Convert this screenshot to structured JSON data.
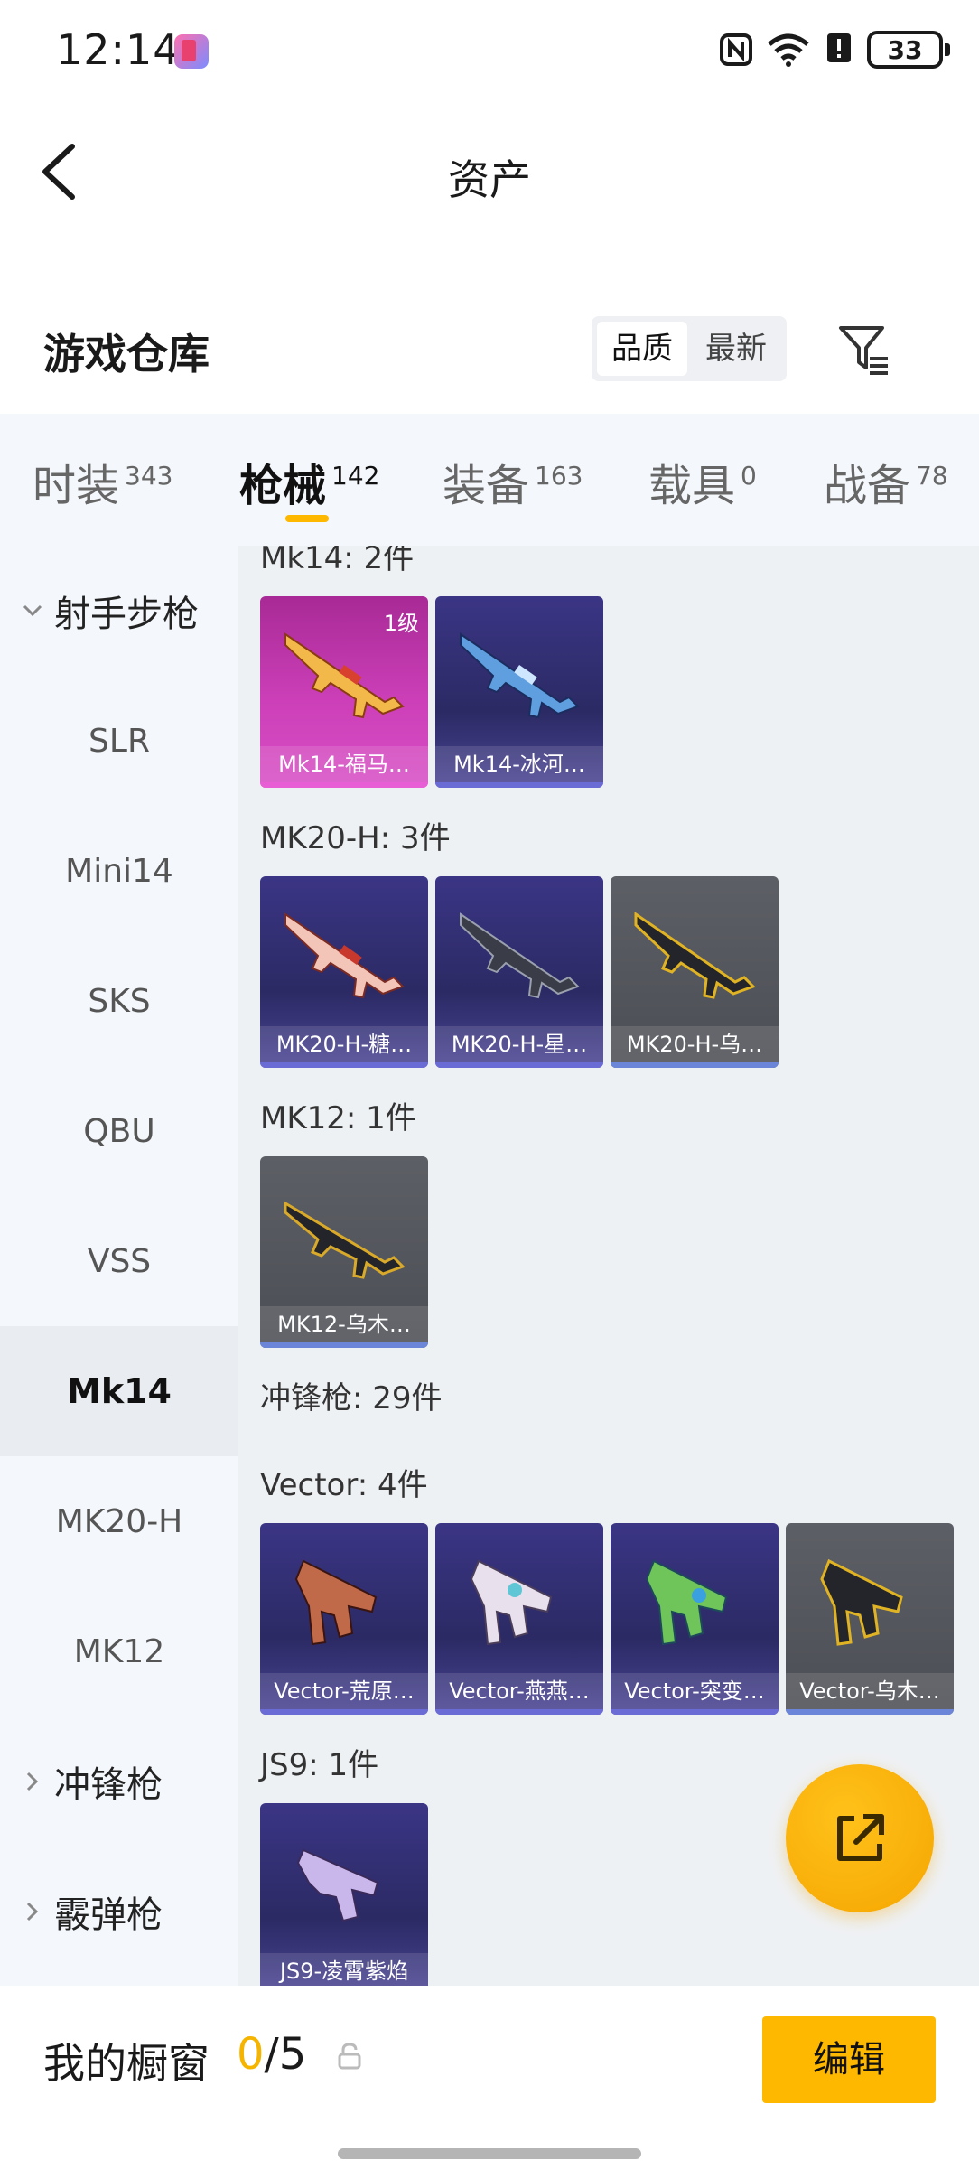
{
  "status_bar": {
    "time": "12:14",
    "battery": "33"
  },
  "header": {
    "title": "资产"
  },
  "warehouse": {
    "title": "游戏仓库",
    "sort_options": [
      "品质",
      "最新"
    ]
  },
  "tabs": [
    {
      "label": "时装",
      "count": "343"
    },
    {
      "label": "枪械",
      "count": "142"
    },
    {
      "label": "装备",
      "count": "163"
    },
    {
      "label": "载具",
      "count": "0"
    },
    {
      "label": "战备",
      "count": "78"
    }
  ],
  "sidebar": {
    "group1": "射手步枪",
    "items": [
      "SLR",
      "Mini14",
      "SKS",
      "QBU",
      "VSS",
      "Mk14",
      "MK20-H",
      "MK12"
    ],
    "group2": "冲锋枪",
    "group3": "霰弹枪"
  },
  "content": {
    "groups": [
      {
        "label": "Mk14: 2件",
        "items": [
          {
            "name": "Mk14-福马…",
            "level": "1级",
            "rarity": "pink"
          },
          {
            "name": "Mk14-冰河…",
            "rarity": "purple"
          }
        ]
      },
      {
        "label": "MK20-H: 3件",
        "items": [
          {
            "name": "MK20-H-糖…",
            "rarity": "purple"
          },
          {
            "name": "MK20-H-星…",
            "rarity": "purple"
          },
          {
            "name": "MK20-H-乌…",
            "rarity": "gray"
          }
        ]
      },
      {
        "label": "MK12: 1件",
        "items": [
          {
            "name": "MK12-乌木…",
            "rarity": "gray"
          }
        ]
      },
      {
        "label": "冲锋枪: 29件"
      },
      {
        "label": "Vector: 4件",
        "items": [
          {
            "name": "Vector-荒原…",
            "rarity": "purple"
          },
          {
            "name": "Vector-燕燕…",
            "rarity": "purple"
          },
          {
            "name": "Vector-突变…",
            "rarity": "purple"
          },
          {
            "name": "Vector-乌木…",
            "rarity": "gray"
          }
        ]
      },
      {
        "label": "JS9: 1件",
        "items": [
          {
            "name": "JS9-凌霄紫焰",
            "rarity": "purple"
          }
        ]
      }
    ]
  },
  "bottom": {
    "showcase_label": "我的橱窗",
    "showcase_used": "0",
    "showcase_total": "/5",
    "edit_label": "编辑"
  },
  "colors": {
    "accent": "#ffb800",
    "rarity_purple": "#3b3585",
    "rarity_pink": "#cc3fb8",
    "rarity_gray": "#55575e"
  },
  "icons": [
    "back-icon",
    "filter-icon",
    "share-icon",
    "lock-icon",
    "chevron-down-icon",
    "chevron-right-icon"
  ]
}
